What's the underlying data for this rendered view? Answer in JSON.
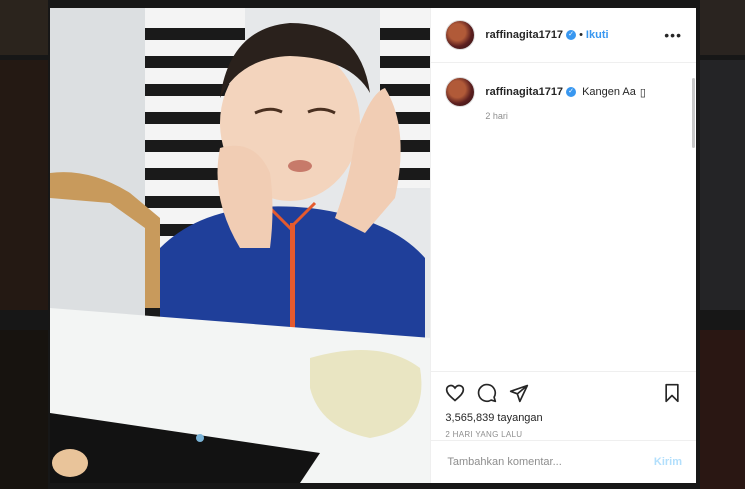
{
  "post": {
    "username": "raffinagita1717",
    "verified_icon": "verified-badge-icon",
    "separator": "•",
    "follow_label": "Ikuti",
    "more_icon": "more-options-icon",
    "more_glyph": "•••"
  },
  "caption": {
    "username": "raffinagita1717",
    "text": "Kangen Aa",
    "emoji_placeholder": "▯",
    "time": "2 hari"
  },
  "actions": {
    "like_icon": "heart-icon",
    "comment_icon": "comment-icon",
    "share_icon": "share-icon",
    "save_icon": "bookmark-icon",
    "views": "3,565,839 tayangan",
    "posted_ago": "2 HARI YANG LALU"
  },
  "comment_box": {
    "placeholder": "Tambahkan komentar...",
    "post_label": "Kirim"
  },
  "colors": {
    "accent": "#3897f0",
    "post_disabled": "#b2dffc"
  }
}
